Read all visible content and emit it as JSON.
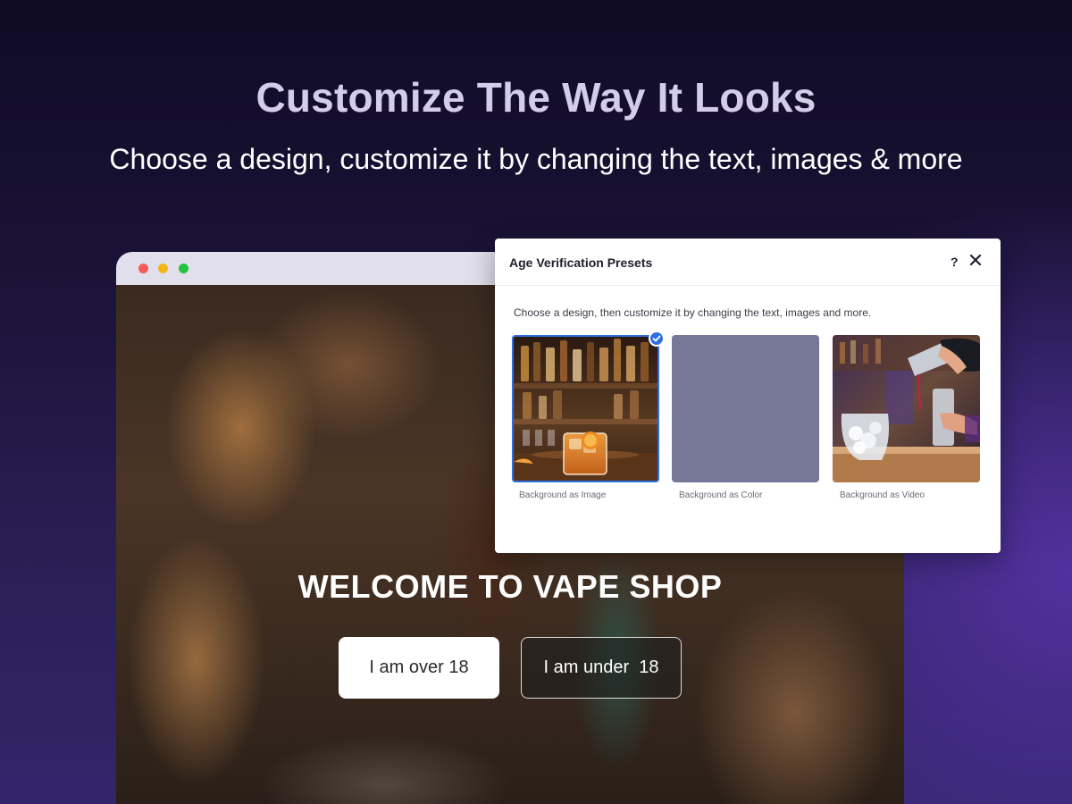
{
  "headline": "Customize The Way It Looks",
  "subheadline": "Choose a design, customize it by changing the text, images & more",
  "browser": {
    "welcome_text": "WELCOME TO VAPE SHOP",
    "button_over": "I am over 18",
    "button_under": "I am under  18"
  },
  "dialog": {
    "title": "Age Verification Presets",
    "help_glyph": "?",
    "description": "Choose a design, then customize it by changing the text, images and more.",
    "presets": [
      {
        "label": "Background as Image",
        "selected": true
      },
      {
        "label": "Background as Color",
        "selected": false,
        "color": "#77779a"
      },
      {
        "label": "Background as Video",
        "selected": false
      }
    ]
  },
  "colors": {
    "accent": "#2f6fe0",
    "headline": "#d4cdea"
  },
  "icons": {
    "window_controls": [
      "close-dot",
      "minimize-dot",
      "maximize-dot"
    ],
    "dialog": [
      "help-icon",
      "close-icon",
      "checkmark-icon"
    ]
  }
}
